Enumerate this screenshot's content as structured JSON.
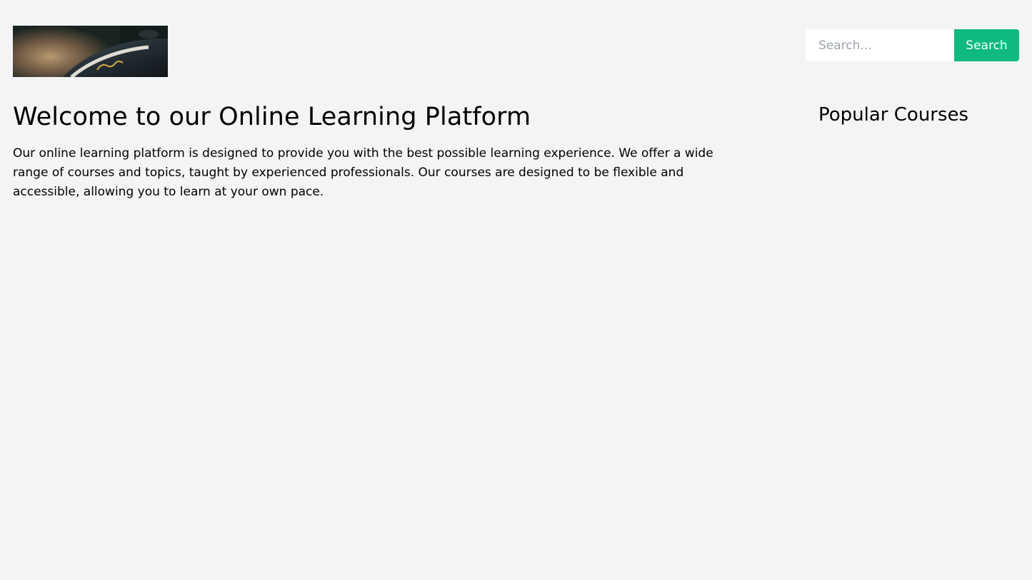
{
  "header": {
    "logo_icon": "logo-image",
    "search": {
      "placeholder": "Search...",
      "value": "",
      "button_label": "Search"
    }
  },
  "main": {
    "title": "Welcome to our Online Learning Platform",
    "description": "Our online learning platform is designed to provide you with the best possible learning experience. We offer a wide range of courses and topics, taught by experienced professionals. Our courses are designed to be flexible and accessible, allowing you to learn at your own pace."
  },
  "sidebar": {
    "heading": "Popular Courses"
  },
  "colors": {
    "background": "#f3f4f6",
    "accent": "#10b981",
    "text": "#000000"
  }
}
